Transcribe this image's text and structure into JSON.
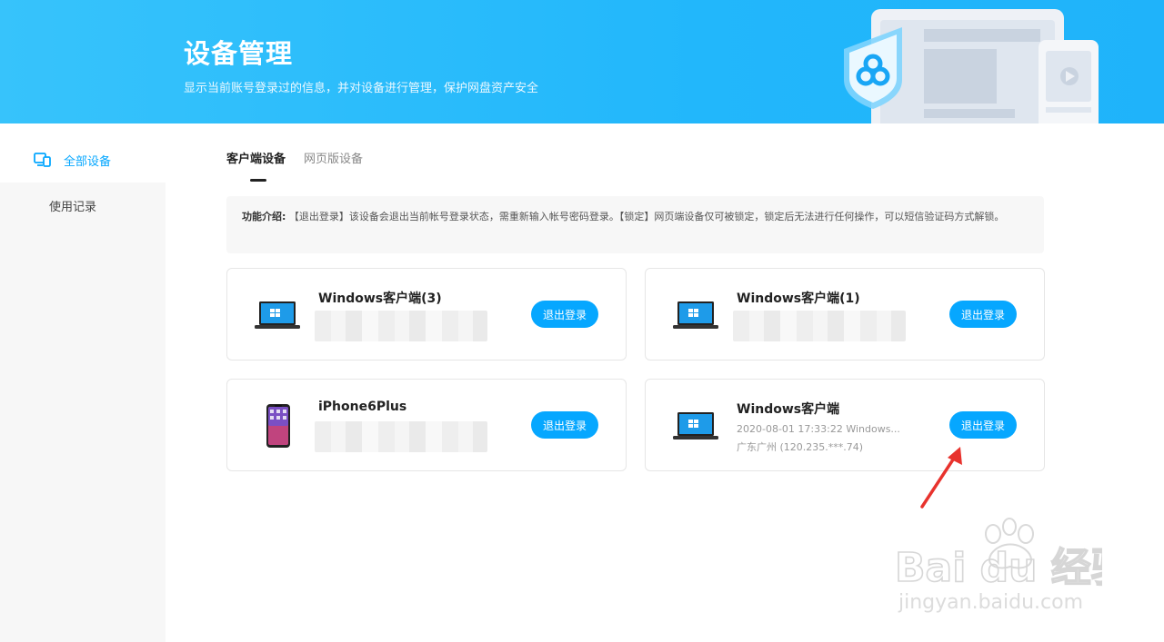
{
  "header": {
    "title": "设备管理",
    "subtitle": "显示当前账号登录过的信息，并对设备进行管理，保护网盘资产安全"
  },
  "sidebar": {
    "items": [
      {
        "label": "全部设备",
        "active": true,
        "icon": "devices-icon"
      },
      {
        "label": "使用记录",
        "active": false
      }
    ]
  },
  "tabs": [
    {
      "label": "客户端设备",
      "active": true
    },
    {
      "label": "网页版设备",
      "active": false
    }
  ],
  "notice": {
    "label": "功能介绍:",
    "text": "【退出登录】该设备会退出当前帐号登录状态，需重新输入帐号密码登录。【锁定】网页端设备仅可被锁定，锁定后无法进行任何操作，可以短信验证码方式解锁。"
  },
  "devices": [
    {
      "name": "Windows客户端(3)",
      "type": "laptop",
      "detail": "",
      "location": "",
      "button": "退出登录",
      "blurred": true
    },
    {
      "name": "Windows客户端(1)",
      "type": "laptop",
      "detail": "",
      "location": "",
      "button": "退出登录",
      "blurred": true
    },
    {
      "name": "iPhone6Plus",
      "type": "phone",
      "detail": "",
      "location": "",
      "button": "退出登录",
      "blurred": true
    },
    {
      "name": "Windows客户端",
      "type": "laptop",
      "detail": "2020-08-01 17:33:22 Windows...",
      "location": "广东广州 (120.235.***.74)",
      "button": "退出登录",
      "blurred": false
    }
  ],
  "watermark": {
    "brand": "Bai du 经验",
    "url": "jingyan.baidu.com"
  },
  "colors": {
    "accent": "#06a7ff",
    "banner": "#22b7fb",
    "arrow": "#e8322d"
  }
}
